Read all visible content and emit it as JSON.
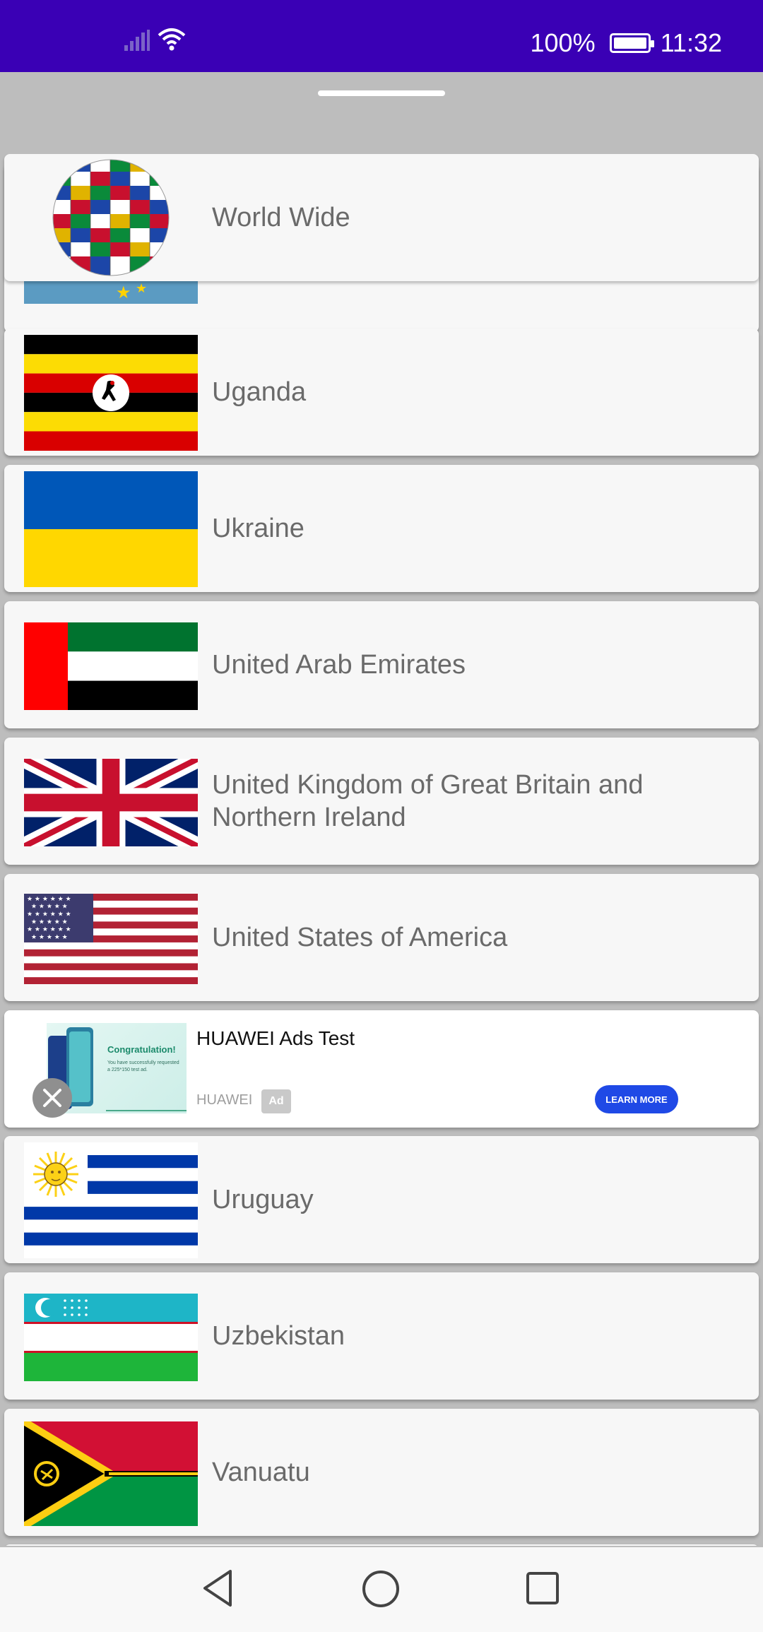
{
  "status_bar": {
    "battery_percent": "100%",
    "time": "11:32"
  },
  "countries": {
    "world_wide": "World Wide",
    "uganda": "Uganda",
    "ukraine": "Ukraine",
    "uae": "United Arab Emirates",
    "uk": "United Kingdom of Great Britain and Northern Ireland",
    "usa": "United States of America",
    "uruguay": "Uruguay",
    "uzbekistan": "Uzbekistan",
    "vanuatu": "Vanuatu"
  },
  "ad": {
    "title": "HUAWEI Ads Test",
    "image_heading": "Congratulation!",
    "image_text": "You have successfully requested a 225*150 test ad.",
    "source": "HUAWEI",
    "badge": "Ad",
    "cta": "LEARN MORE"
  },
  "nav": {
    "back": "back-icon",
    "home": "home-icon",
    "recents": "recents-icon"
  },
  "colors": {
    "status_bar": "#3a00b5",
    "ad_button": "#1f49e6"
  }
}
